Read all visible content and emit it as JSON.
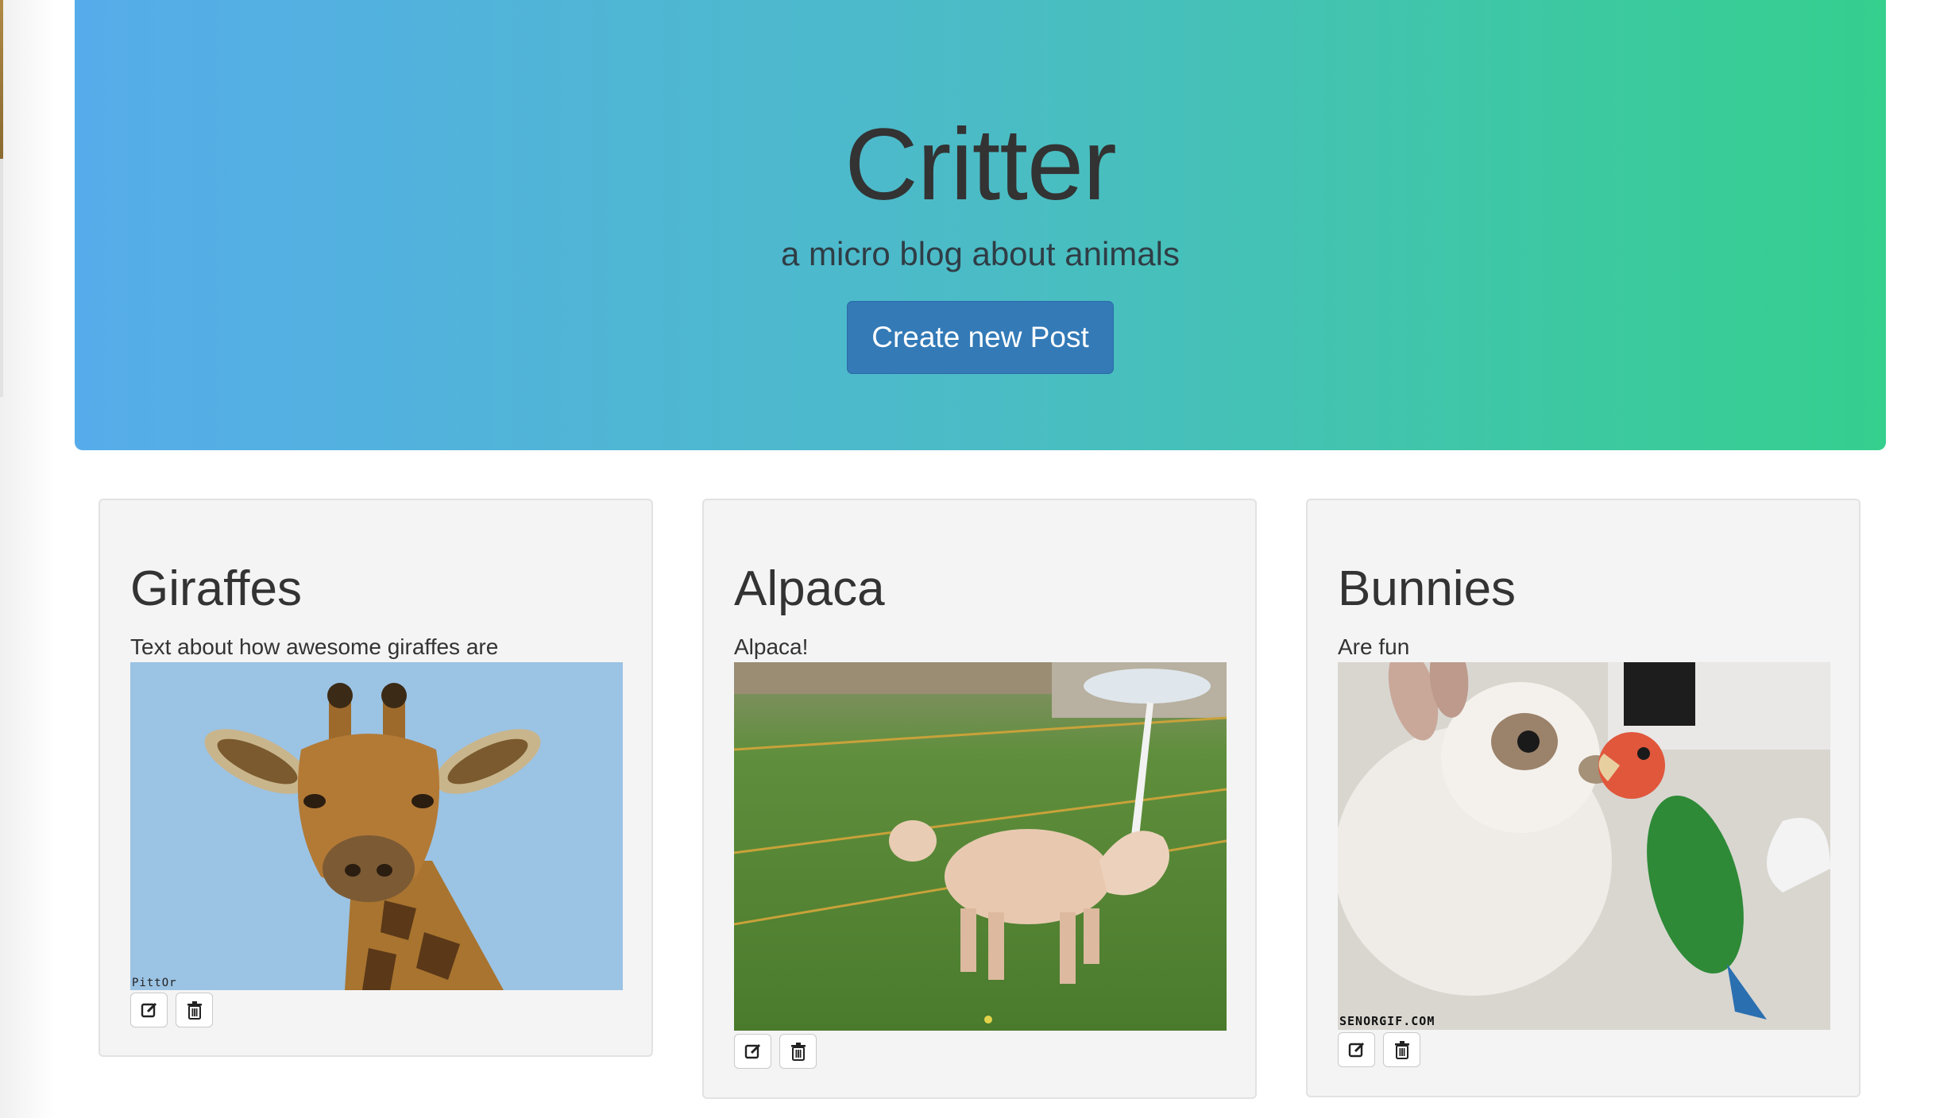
{
  "hero": {
    "title": "Critter",
    "subtitle": "a micro blog about animals",
    "create_button_label": "Create new Post",
    "colors": {
      "gradient_start": "#56acea",
      "gradient_end": "#35cf8e",
      "button": "#337ab7"
    }
  },
  "posts": [
    {
      "title": "Giraffes",
      "text": "Text about how awesome giraffes are",
      "image_subject": "giraffe",
      "watermark": "PittOr",
      "actions": {
        "edit_icon": "edit-icon",
        "delete_icon": "trash-icon"
      }
    },
    {
      "title": "Alpaca",
      "text": "Alpaca!",
      "image_subject": "alpaca",
      "watermark": "",
      "actions": {
        "edit_icon": "edit-icon",
        "delete_icon": "trash-icon"
      }
    },
    {
      "title": "Bunnies",
      "text": "Are fun",
      "image_subject": "bunny-and-parrot",
      "watermark": "SENORGIF.COM",
      "actions": {
        "edit_icon": "edit-icon",
        "delete_icon": "trash-icon"
      }
    }
  ]
}
